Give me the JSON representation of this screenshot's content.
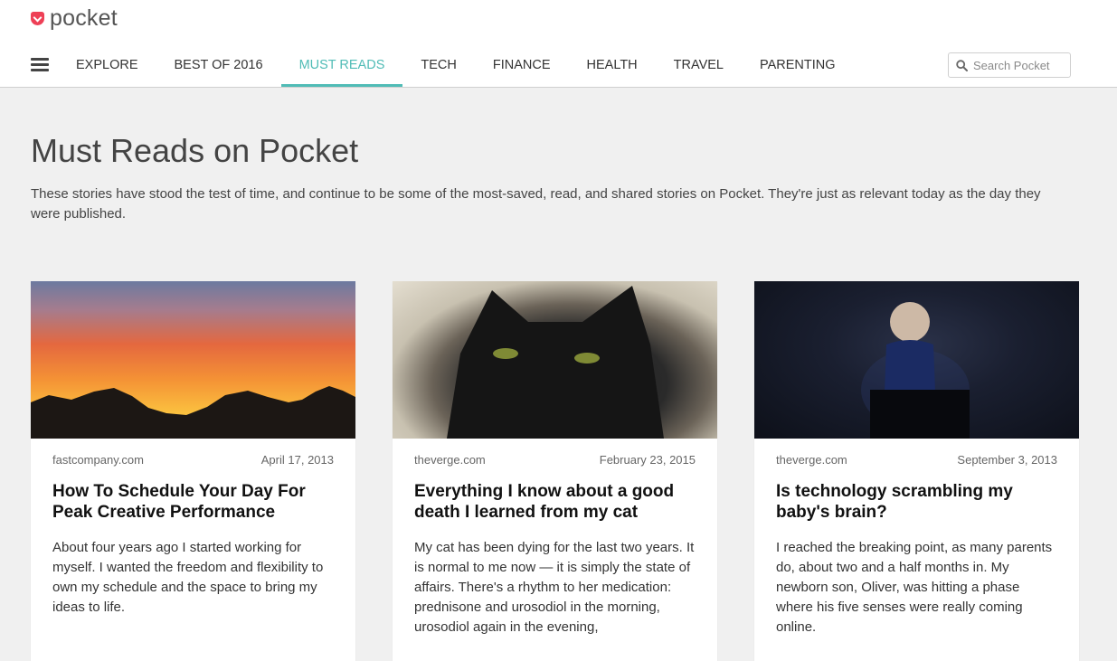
{
  "brand": {
    "name": "pocket"
  },
  "nav": {
    "tabs": [
      {
        "label": "EXPLORE",
        "active": false
      },
      {
        "label": "BEST OF 2016",
        "active": false
      },
      {
        "label": "MUST READS",
        "active": true
      },
      {
        "label": "TECH",
        "active": false
      },
      {
        "label": "FINANCE",
        "active": false
      },
      {
        "label": "HEALTH",
        "active": false
      },
      {
        "label": "TRAVEL",
        "active": false
      },
      {
        "label": "PARENTING",
        "active": false
      }
    ]
  },
  "search": {
    "placeholder": "Search Pocket",
    "icon": "search-icon"
  },
  "page": {
    "title": "Must Reads on Pocket",
    "description": "These stories have stood the test of time, and continue to be some of the most-saved, read, and shared stories on Pocket. They're just as relevant today as the day they were published."
  },
  "cards": [
    {
      "source": "fastcompany.com",
      "date": "April 17, 2013",
      "title": "How To Schedule Your Day For Peak Creative Performance",
      "excerpt": "About four years ago I started working for myself. I wanted the freedom and flexibility to own my schedule and the space to bring my ideas to life."
    },
    {
      "source": "theverge.com",
      "date": "February 23, 2015",
      "title": "Everything I know about a good death I learned from my cat",
      "excerpt": "My cat has been dying for the last two years. It is normal to me now — it is simply the state of affairs. There's a rhythm to her medication: prednisone and urosodiol in the morning, urosodiol again in the evening,"
    },
    {
      "source": "theverge.com",
      "date": "September 3, 2013",
      "title": "Is technology scrambling my baby's brain?",
      "excerpt": "I reached the breaking point, as many parents do, about two and a half months in. My newborn son, Oliver, was hitting a phase where his five senses were really coming online."
    }
  ],
  "colors": {
    "accent": "#50bcb6",
    "brand": "#ee4056",
    "background": "#f0f0f0"
  }
}
